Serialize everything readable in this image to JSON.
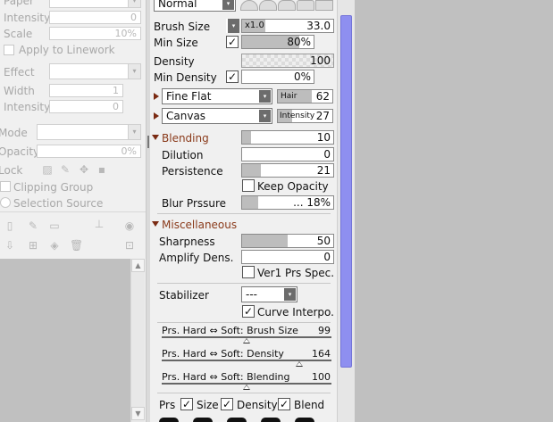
{
  "left_panel": {
    "paper_label": "Paper",
    "intensity_label": "Intensity",
    "intensity_value": "0",
    "scale_label": "Scale",
    "scale_value": "10%",
    "apply_linework_label": "Apply to Linework",
    "effect_label": "Effect",
    "width_label": "Width",
    "width_value": "1",
    "effect_intensity_label": "Intensity",
    "effect_intensity_value": "0",
    "mode_label": "Mode",
    "opacity_label": "Opacity",
    "opacity_value": "0%",
    "lock_label": "Lock",
    "clipping_group_label": "Clipping Group",
    "selection_source_label": "Selection Source"
  },
  "brush": {
    "blend_mode": "Normal",
    "brush_size_label": "Brush Size",
    "brush_size_multiplier": "x1.0",
    "brush_size_value": "33.0",
    "brush_size_level": 0.25,
    "min_size_label": "Min Size",
    "min_size_checked": true,
    "min_size_value": "80%",
    "min_size_level": 0.8,
    "density_label": "Density",
    "density_value": "100",
    "min_density_label": "Min Density",
    "min_density_checked": true,
    "min_density_value": "0%",
    "shape_type": "Fine Flat",
    "shape_param_label": "Hair",
    "shape_param_value": "62",
    "shape_level": 0.62,
    "texture_type": "Canvas",
    "texture_param_label": "Intensity",
    "texture_param_value": "27",
    "texture_level": 0.27
  },
  "blending": {
    "title": "Blending",
    "blending_value": "10",
    "blending_level": 0.1,
    "dilution_label": "Dilution",
    "dilution_value": "0",
    "persistence_label": "Persistence",
    "persistence_value": "21",
    "persistence_level": 0.21,
    "keep_opacity_label": "Keep Opacity",
    "keep_opacity_checked": false,
    "blur_pressure_label": "Blur Prssure",
    "blur_pressure_value": "... 18%",
    "blur_pressure_level": 0.18
  },
  "misc": {
    "title": "Miscellaneous",
    "sharpness_label": "Sharpness",
    "sharpness_value": "50",
    "sharpness_level": 0.5,
    "amplify_label": "Amplify Dens.",
    "amplify_value": "0",
    "ver1_label": "Ver1 Prs Spec.",
    "ver1_checked": false,
    "stabilizer_label": "Stabilizer",
    "stabilizer_value": "---",
    "curve_interp_label": "Curve Interpo.",
    "curve_interp_checked": true
  },
  "pressure": {
    "rows": [
      {
        "label": "Prs. Hard ⇔ Soft: Brush Size",
        "value": "99",
        "level": 0.5
      },
      {
        "label": "Prs. Hard ⇔ Soft: Density",
        "value": "164",
        "level": 0.81
      },
      {
        "label": "Prs. Hard ⇔ Soft: Blending",
        "value": "100",
        "level": 0.5
      }
    ],
    "prs_label": "Prs",
    "size_label": "Size",
    "size_checked": true,
    "density_label": "Density",
    "density_checked": true,
    "blend_label": "Blend",
    "blend_checked": true
  },
  "icons": {
    "dropdown": "▾",
    "check": "✓"
  }
}
